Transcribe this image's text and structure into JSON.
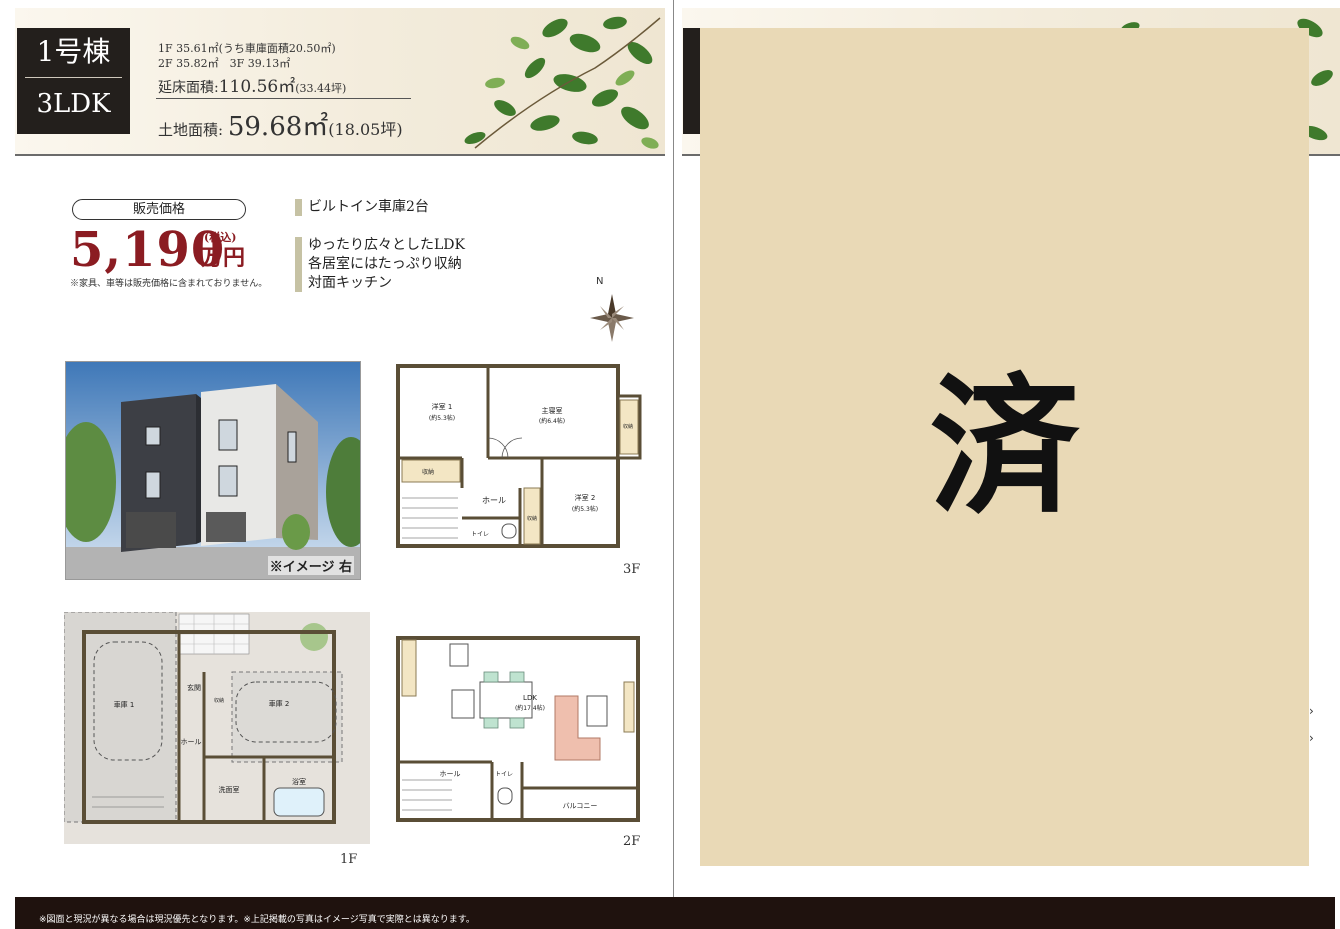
{
  "listing": {
    "unit_name": "1号棟",
    "layout_type": "3LDK",
    "floor_areas_line1": "1F 35.61㎡(うち車庫面積20.50㎡)",
    "floor_areas_line2": "2F 35.82㎡　3F 39.13㎡",
    "total_floor_label": "延床面積:",
    "total_floor_value": "110.56㎡",
    "total_floor_tsubo": "(33.44坪)",
    "land_label": "土地面積:",
    "land_value": "59.68㎡",
    "land_tsubo": "(18.05坪)"
  },
  "price": {
    "label": "販売価格",
    "value": "5,190",
    "tax": "(税込)",
    "unit": "万円",
    "note": "※家具、車等は販売価格に含まれておりません。"
  },
  "features": {
    "garage": "ビルトイン車庫2台",
    "line1": "ゆったり広々としたLDK",
    "line2": "各居室にはたっぷり収納",
    "line3": "対面キッチン"
  },
  "compass_letter": "N",
  "photo_caption": "※イメージ 右",
  "floor_labels": {
    "f1": "1F",
    "f2": "2F",
    "f3": "3F"
  },
  "rooms": {
    "r3_western1": "洋室 1",
    "r3_western1_size": "(約5.3帖)",
    "r3_master": "主寝室",
    "r3_master_size": "(約6.4帖)",
    "r3_closet": "収納",
    "r3_closet2": "収納",
    "r3_closet3": "収納",
    "r3_hall": "ホール",
    "r3_western2": "洋室 2",
    "r3_western2_size": "(約5.3帖)",
    "r3_toilet": "トイレ",
    "r1_garage1": "車庫 1",
    "r1_garage2": "車庫 2",
    "r1_entrance": "玄関",
    "r1_shoe": "収納",
    "r1_hall": "ホール",
    "r1_washroom": "洗面室",
    "r1_bath": "浴室",
    "r2_ldk": "LDK",
    "r2_ldk_size": "(約17.4帖)",
    "r2_hall": "ホール",
    "r2_toilet": "トイレ",
    "r2_balcony": "バルコニー"
  },
  "sold_mark": "済",
  "footer_note": "※図面と現況が異なる場合は現況優先となります。※上記掲載の写真はイメージ写真で実際とは異なります。",
  "colors": {
    "price_red": "#8b1c22",
    "header_dark": "#231f1c",
    "sold_panel": "#e9d9b6",
    "footer": "#1f120e"
  },
  "icons": [
    "compass-icon",
    "chevron-right-icon"
  ]
}
